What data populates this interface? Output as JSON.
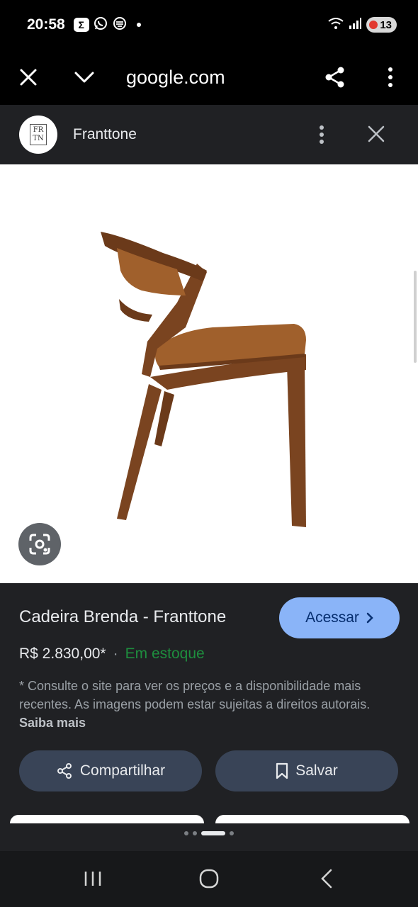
{
  "status_bar": {
    "time": "20:58",
    "left_icons": [
      "sigma-app-icon",
      "whatsapp-icon",
      "stack-app-icon"
    ],
    "battery_level": "13"
  },
  "browser": {
    "url": "google.com"
  },
  "panel": {
    "site_name": "Franttone",
    "logo_text_line1": "FR",
    "logo_text_line2": "TN"
  },
  "product": {
    "title": "Cadeira Brenda - Franttone",
    "visit_label": "Acessar",
    "price": "R$ 2.830,00*",
    "separator": "·",
    "stock": "Em estoque",
    "disclaimer": "* Consulte o site para ver os preços e a disponibilidade mais recentes. As imagens podem estar sujeitas a direitos autorais.",
    "learn_more": "Saiba mais",
    "share_label": "Compartilhar",
    "save_label": "Salvar"
  },
  "carousel": {
    "page_count": 4,
    "active_index": 2
  },
  "colors": {
    "panel_bg": "#202124",
    "accent_button": "#8ab4f8",
    "stock_green": "#1e8e3e",
    "action_button": "#394457",
    "chair_wood": "#7a4420",
    "chair_leather": "#a0602c"
  }
}
